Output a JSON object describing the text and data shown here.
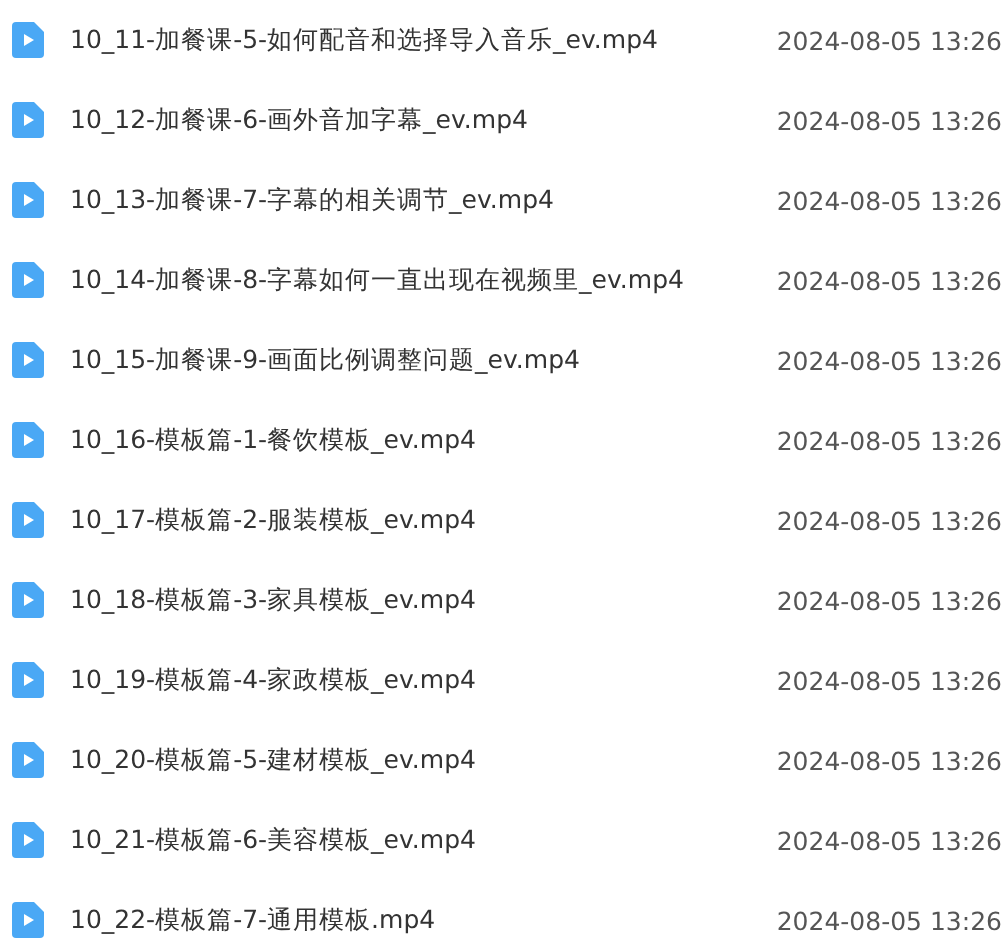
{
  "files": [
    {
      "name": "10_11-加餐课-5-如何配音和选择导入音乐_ev.mp4",
      "modified": "2024-08-05 13:26"
    },
    {
      "name": "10_12-加餐课-6-画外音加字幕_ev.mp4",
      "modified": "2024-08-05 13:26"
    },
    {
      "name": "10_13-加餐课-7-字幕的相关调节_ev.mp4",
      "modified": "2024-08-05 13:26"
    },
    {
      "name": "10_14-加餐课-8-字幕如何一直出现在视频里_ev.mp4",
      "modified": "2024-08-05 13:26"
    },
    {
      "name": "10_15-加餐课-9-画面比例调整问题_ev.mp4",
      "modified": "2024-08-05 13:26"
    },
    {
      "name": "10_16-模板篇-1-餐饮模板_ev.mp4",
      "modified": "2024-08-05 13:26"
    },
    {
      "name": "10_17-模板篇-2-服装模板_ev.mp4",
      "modified": "2024-08-05 13:26"
    },
    {
      "name": "10_18-模板篇-3-家具模板_ev.mp4",
      "modified": "2024-08-05 13:26"
    },
    {
      "name": "10_19-模板篇-4-家政模板_ev.mp4",
      "modified": "2024-08-05 13:26"
    },
    {
      "name": "10_20-模板篇-5-建材模板_ev.mp4",
      "modified": "2024-08-05 13:26"
    },
    {
      "name": "10_21-模板篇-6-美容模板_ev.mp4",
      "modified": "2024-08-05 13:26"
    },
    {
      "name": "10_22-模板篇-7-通用模板.mp4",
      "modified": "2024-08-05 13:26"
    }
  ]
}
